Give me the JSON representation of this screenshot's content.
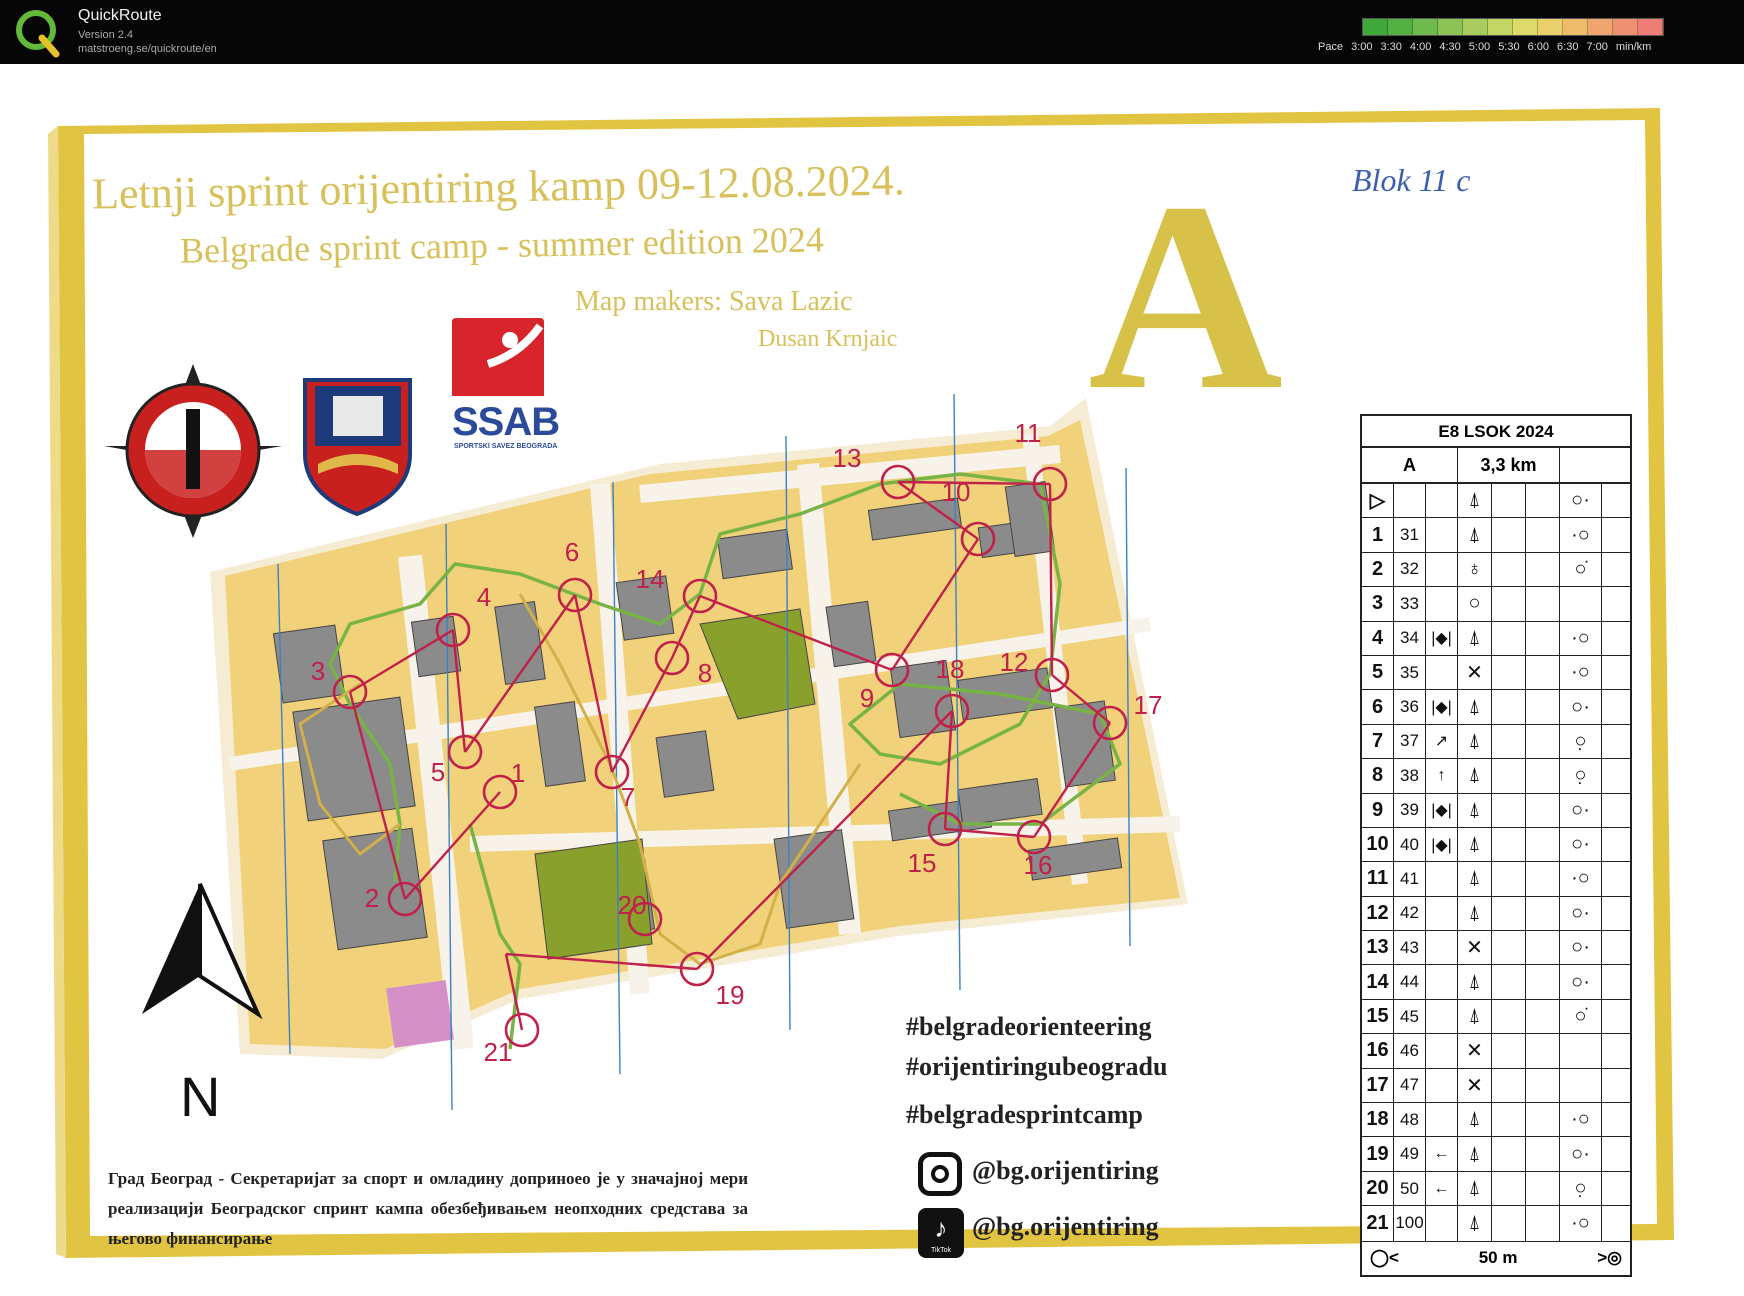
{
  "app": {
    "title": "QuickRoute",
    "version": "Version 2.4",
    "url": "matstroeng.se/quickroute/en"
  },
  "pace_legend": {
    "prefix": "Pace",
    "labels": [
      "3:00",
      "3:30",
      "4:00",
      "4:30",
      "5:00",
      "5:30",
      "6:00",
      "6:30",
      "7:00"
    ],
    "unit": "min/km",
    "colors": [
      "#3fa83a",
      "#55b043",
      "#6fba4c",
      "#8cc256",
      "#a8cc5e",
      "#c3d564",
      "#ddd96b",
      "#ead06a",
      "#eebb6a",
      "#efa56d",
      "#ef9070",
      "#ee7d74"
    ]
  },
  "map": {
    "title_line1": "Letnji sprint orijentiring kamp 09-12.08.2024.",
    "title_line2": "Belgrade sprint camp - summer edition 2024",
    "map_makers": "Map makers: Sava Lazic",
    "map_makers_2": "Dusan Krnjaic",
    "course_letter": "A",
    "handwritten_note": "Blok 11 c",
    "ssab_logo_text": "SSAB",
    "ssab_logo_sub": "SPORTSKI SAVEZ BEOGRADA",
    "north_letter": "N",
    "hashtags": [
      "#belgradeorienteering",
      "#orijentiringubeogradu",
      "#belgradesprintcamp"
    ],
    "instagram": "@bg.orijentiring",
    "tiktok": "@bg.orijentiring",
    "tiktok_icon_text": "TikTok",
    "sponsor_text": "Град Београд - Секретаријат за спорт и омладину доприноео је у значајној мери реализацији Београдског спринт кампа обезбеђивањем неопходних средстава за његово финансирање",
    "control_numbers": [
      "1",
      "2",
      "3",
      "4",
      "5",
      "6",
      "7",
      "8",
      "9",
      "10",
      "11",
      "12",
      "13",
      "14",
      "15",
      "16",
      "17",
      "18",
      "19",
      "20",
      "21"
    ]
  },
  "control_descriptions": {
    "title": "E8 LSOK 2024",
    "course": "A",
    "distance": "3,3 km",
    "start_symbol": "▷",
    "rows": [
      {
        "num": "1",
        "code": "31",
        "c3": "",
        "feature": "⍋",
        "pos": "·○"
      },
      {
        "num": "2",
        "code": "32",
        "c3": "",
        "feature": "♁",
        "pos": "○̇"
      },
      {
        "num": "3",
        "code": "33",
        "c3": "",
        "feature": "○",
        "pos": ""
      },
      {
        "num": "4",
        "code": "34",
        "c3": "|◆|",
        "feature": "⍋",
        "pos": "·○"
      },
      {
        "num": "5",
        "code": "35",
        "c3": "",
        "feature": "✕",
        "pos": "·○"
      },
      {
        "num": "6",
        "code": "36",
        "c3": "|◆|",
        "feature": "⍋",
        "pos": "○·"
      },
      {
        "num": "7",
        "code": "37",
        "c3": "↗",
        "feature": "⍋",
        "pos": "○̣"
      },
      {
        "num": "8",
        "code": "38",
        "c3": "↑",
        "feature": "⍋",
        "pos": "○̣"
      },
      {
        "num": "9",
        "code": "39",
        "c3": "|◆|",
        "feature": "⍋",
        "pos": "○·"
      },
      {
        "num": "10",
        "code": "40",
        "c3": "|◆|",
        "feature": "⍋",
        "pos": "○·"
      },
      {
        "num": "11",
        "code": "41",
        "c3": "",
        "feature": "⍋",
        "pos": "·○"
      },
      {
        "num": "12",
        "code": "42",
        "c3": "",
        "feature": "⍋",
        "pos": "○·"
      },
      {
        "num": "13",
        "code": "43",
        "c3": "",
        "feature": "✕",
        "pos": "○·"
      },
      {
        "num": "14",
        "code": "44",
        "c3": "",
        "feature": "⍋",
        "pos": "○·"
      },
      {
        "num": "15",
        "code": "45",
        "c3": "",
        "feature": "⍋",
        "pos": "○̇"
      },
      {
        "num": "16",
        "code": "46",
        "c3": "",
        "feature": "✕",
        "pos": ""
      },
      {
        "num": "17",
        "code": "47",
        "c3": "",
        "feature": "✕",
        "pos": ""
      },
      {
        "num": "18",
        "code": "48",
        "c3": "",
        "feature": "⍋",
        "pos": "·○"
      },
      {
        "num": "19",
        "code": "49",
        "c3": "←",
        "feature": "⍋",
        "pos": "○·"
      },
      {
        "num": "20",
        "code": "50",
        "c3": "←",
        "feature": "⍋",
        "pos": "○̣"
      },
      {
        "num": "21",
        "code": "100",
        "c3": "",
        "feature": "⍋",
        "pos": "·○"
      }
    ],
    "start_feature": "⍋",
    "start_pos": "○·",
    "finish_distance": "50 m"
  },
  "colors": {
    "frame_gold": "#e2c443",
    "control_purple": "#c0204a",
    "map_orange": "#f1d27a",
    "building_grey": "#8b8b8b",
    "vegetation_green": "#8aa02c"
  }
}
